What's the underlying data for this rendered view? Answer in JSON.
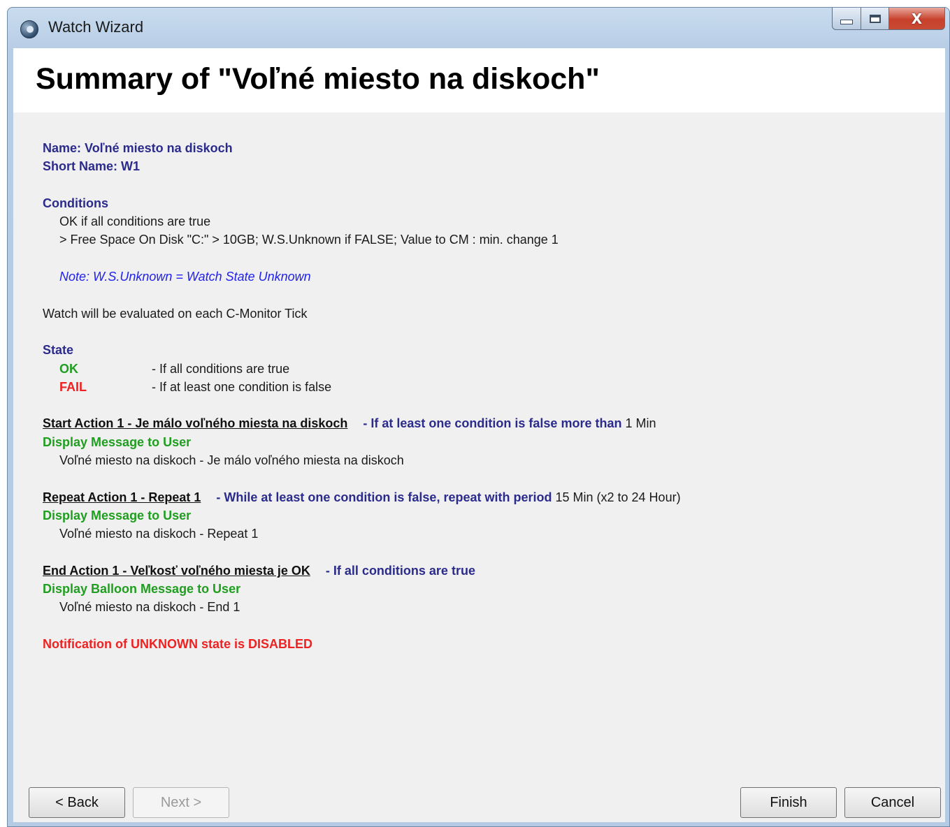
{
  "window": {
    "title": "Watch Wizard",
    "close_glyph": "X"
  },
  "header": {
    "title": "Summary of \"Voľné miesto na diskoch\""
  },
  "summary": {
    "name": "Name: Voľné miesto na diskoch",
    "short_name": "Short Name: W1",
    "conditions_heading": "Conditions",
    "conditions_mode": "OK if all conditions are true",
    "condition_1": "> Free Space On Disk \"C:\" > 10GB; W.S.Unknown if FALSE; Value to CM : min. change 1",
    "note": "Note: W.S.Unknown = Watch State Unknown",
    "evaluation": "Watch will be evaluated on each C-Monitor Tick",
    "state_heading": "State",
    "state_ok": "OK",
    "state_ok_desc": "- If all conditions are true",
    "state_fail": "FAIL",
    "state_fail_desc": "- If at least one condition is false",
    "start_action_title": "Start Action 1 - Je málo voľného miesta na diskoch",
    "start_action_trigger": "- If at least one condition is false more than",
    "start_action_time": "1 Min",
    "start_action_type": "Display Message to User",
    "start_action_message": "Voľné miesto na diskoch - Je málo voľného miesta na diskoch",
    "repeat_action_title": "Repeat Action 1 - Repeat 1",
    "repeat_action_trigger": "- While at least one condition is false, repeat with period",
    "repeat_action_period": "15 Min (x2 to 24 Hour)",
    "repeat_action_type": "Display Message to User",
    "repeat_action_message": "Voľné miesto na diskoch - Repeat 1",
    "end_action_title": "End Action 1 - Veľkosť voľného miesta je OK",
    "end_action_trigger": "- If all conditions are true",
    "end_action_type": "Display Balloon Message to User",
    "end_action_message": "Voľné miesto na diskoch - End 1",
    "unknown_notification": "Notification of UNKNOWN state is DISABLED"
  },
  "buttons": {
    "back": "< Back",
    "next": "Next >",
    "finish": "Finish",
    "cancel": "Cancel"
  },
  "colors": {
    "navy": "#2b2b8c",
    "green": "#1f9e1f",
    "red": "#ee2222",
    "note_blue": "#2222ee"
  }
}
